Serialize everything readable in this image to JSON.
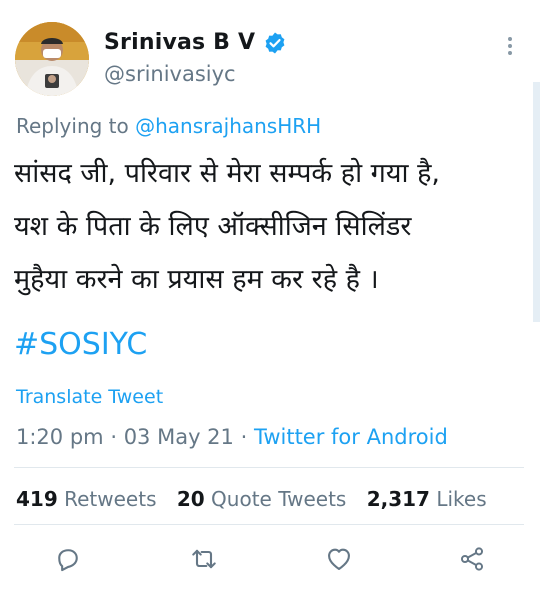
{
  "user": {
    "display_name": "Srinivas B V",
    "handle": "@srinivasiyc",
    "verified": true
  },
  "reply": {
    "prefix": "Replying to",
    "mention": "@hansrajhansHRH"
  },
  "tweet": {
    "lines": [
      "सांसद जी, परिवार से मेरा सम्पर्क हो गया है,",
      "यश के पिता के लिए ऑक्सीजिन सिलिंडर",
      "मुहैया करने का प्रयास हम कर रहे है ।"
    ],
    "hashtag": "#SOSIYC",
    "translate_label": "Translate Tweet"
  },
  "meta": {
    "time": "1:20 pm",
    "date": "03 May 21",
    "source": "Twitter for Android"
  },
  "stats": {
    "retweets_count": "419",
    "retweets_label": "Retweets",
    "quotes_count": "20",
    "quotes_label": "Quote Tweets",
    "likes_count": "2,317",
    "likes_label": "Likes"
  },
  "colors": {
    "accent": "#1da1f2",
    "muted": "#657786",
    "text": "#14171a",
    "divider": "#e1e8ed"
  },
  "icons": [
    "verified-badge-icon",
    "more-options-icon",
    "reply-icon",
    "retweet-icon",
    "like-icon",
    "share-icon"
  ]
}
